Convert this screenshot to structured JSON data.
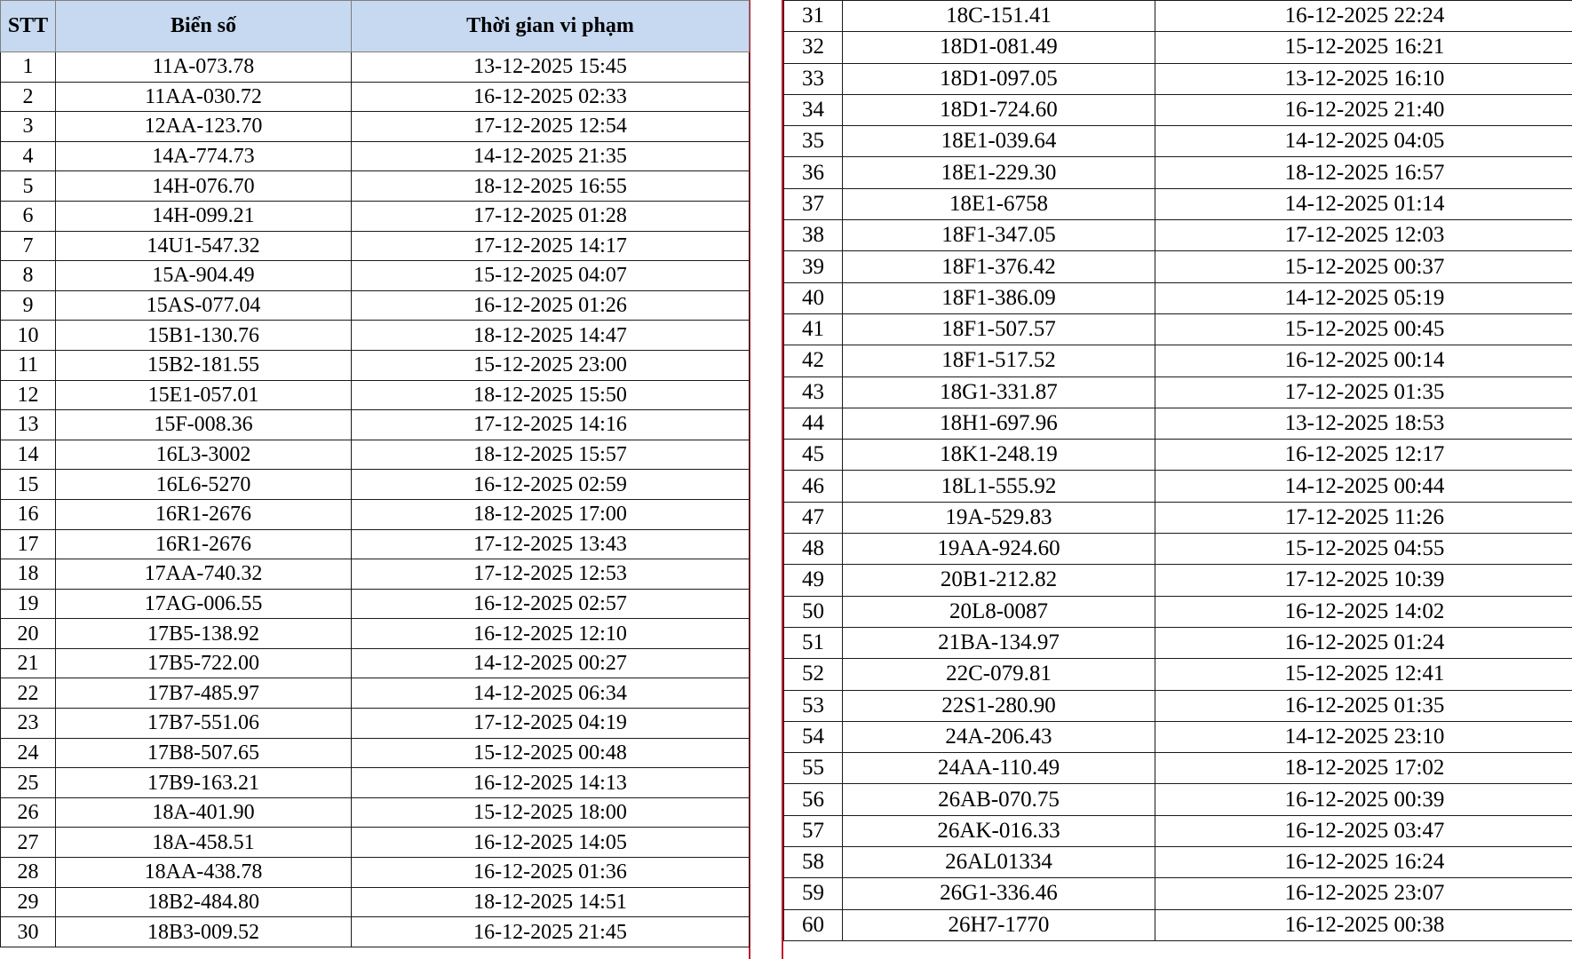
{
  "headers": {
    "stt": "STT",
    "plate": "Biển số",
    "time": "Thời gian vi phạm"
  },
  "colors": {
    "header_bg": "#c6d9f1",
    "divider": "#c01a2a"
  },
  "left_rows": [
    {
      "stt": "1",
      "plate": "11A-073.78",
      "time": "13-12-2025 15:45"
    },
    {
      "stt": "2",
      "plate": "11AA-030.72",
      "time": "16-12-2025 02:33"
    },
    {
      "stt": "3",
      "plate": "12AA-123.70",
      "time": "17-12-2025 12:54"
    },
    {
      "stt": "4",
      "plate": "14A-774.73",
      "time": "14-12-2025 21:35"
    },
    {
      "stt": "5",
      "plate": "14H-076.70",
      "time": "18-12-2025 16:55"
    },
    {
      "stt": "6",
      "plate": "14H-099.21",
      "time": "17-12-2025 01:28"
    },
    {
      "stt": "7",
      "plate": "14U1-547.32",
      "time": "17-12-2025 14:17"
    },
    {
      "stt": "8",
      "plate": "15A-904.49",
      "time": "15-12-2025 04:07"
    },
    {
      "stt": "9",
      "plate": "15AS-077.04",
      "time": "16-12-2025 01:26"
    },
    {
      "stt": "10",
      "plate": "15B1-130.76",
      "time": "18-12-2025 14:47"
    },
    {
      "stt": "11",
      "plate": "15B2-181.55",
      "time": "15-12-2025 23:00"
    },
    {
      "stt": "12",
      "plate": "15E1-057.01",
      "time": "18-12-2025 15:50"
    },
    {
      "stt": "13",
      "plate": "15F-008.36",
      "time": "17-12-2025 14:16"
    },
    {
      "stt": "14",
      "plate": "16L3-3002",
      "time": "18-12-2025 15:57"
    },
    {
      "stt": "15",
      "plate": "16L6-5270",
      "time": "16-12-2025 02:59"
    },
    {
      "stt": "16",
      "plate": "16R1-2676",
      "time": "18-12-2025 17:00"
    },
    {
      "stt": "17",
      "plate": "16R1-2676",
      "time": "17-12-2025 13:43"
    },
    {
      "stt": "18",
      "plate": "17AA-740.32",
      "time": "17-12-2025 12:53"
    },
    {
      "stt": "19",
      "plate": "17AG-006.55",
      "time": "16-12-2025 02:57"
    },
    {
      "stt": "20",
      "plate": "17B5-138.92",
      "time": "16-12-2025 12:10"
    },
    {
      "stt": "21",
      "plate": "17B5-722.00",
      "time": "14-12-2025 00:27"
    },
    {
      "stt": "22",
      "plate": "17B7-485.97",
      "time": "14-12-2025 06:34"
    },
    {
      "stt": "23",
      "plate": "17B7-551.06",
      "time": "17-12-2025 04:19"
    },
    {
      "stt": "24",
      "plate": "17B8-507.65",
      "time": "15-12-2025 00:48"
    },
    {
      "stt": "25",
      "plate": "17B9-163.21",
      "time": "16-12-2025 14:13"
    },
    {
      "stt": "26",
      "plate": "18A-401.90",
      "time": "15-12-2025 18:00"
    },
    {
      "stt": "27",
      "plate": "18A-458.51",
      "time": "16-12-2025 14:05"
    },
    {
      "stt": "28",
      "plate": "18AA-438.78",
      "time": "16-12-2025 01:36"
    },
    {
      "stt": "29",
      "plate": "18B2-484.80",
      "time": "18-12-2025 14:51"
    },
    {
      "stt": "30",
      "plate": "18B3-009.52",
      "time": "16-12-2025 21:45"
    }
  ],
  "right_rows": [
    {
      "stt": "31",
      "plate": "18C-151.41",
      "time": "16-12-2025 22:24"
    },
    {
      "stt": "32",
      "plate": "18D1-081.49",
      "time": "15-12-2025 16:21"
    },
    {
      "stt": "33",
      "plate": "18D1-097.05",
      "time": "13-12-2025 16:10"
    },
    {
      "stt": "34",
      "plate": "18D1-724.60",
      "time": "16-12-2025 21:40"
    },
    {
      "stt": "35",
      "plate": "18E1-039.64",
      "time": "14-12-2025 04:05"
    },
    {
      "stt": "36",
      "plate": "18E1-229.30",
      "time": "18-12-2025 16:57"
    },
    {
      "stt": "37",
      "plate": "18E1-6758",
      "time": "14-12-2025 01:14"
    },
    {
      "stt": "38",
      "plate": "18F1-347.05",
      "time": "17-12-2025 12:03"
    },
    {
      "stt": "39",
      "plate": "18F1-376.42",
      "time": "15-12-2025 00:37"
    },
    {
      "stt": "40",
      "plate": "18F1-386.09",
      "time": "14-12-2025 05:19"
    },
    {
      "stt": "41",
      "plate": "18F1-507.57",
      "time": "15-12-2025 00:45"
    },
    {
      "stt": "42",
      "plate": "18F1-517.52",
      "time": "16-12-2025 00:14"
    },
    {
      "stt": "43",
      "plate": "18G1-331.87",
      "time": "17-12-2025 01:35"
    },
    {
      "stt": "44",
      "plate": "18H1-697.96",
      "time": "13-12-2025 18:53"
    },
    {
      "stt": "45",
      "plate": "18K1-248.19",
      "time": "16-12-2025 12:17"
    },
    {
      "stt": "46",
      "plate": "18L1-555.92",
      "time": "14-12-2025 00:44"
    },
    {
      "stt": "47",
      "plate": "19A-529.83",
      "time": "17-12-2025 11:26"
    },
    {
      "stt": "48",
      "plate": "19AA-924.60",
      "time": "15-12-2025 04:55"
    },
    {
      "stt": "49",
      "plate": "20B1-212.82",
      "time": "17-12-2025 10:39"
    },
    {
      "stt": "50",
      "plate": "20L8-0087",
      "time": "16-12-2025 14:02"
    },
    {
      "stt": "51",
      "plate": "21BA-134.97",
      "time": "16-12-2025 01:24"
    },
    {
      "stt": "52",
      "plate": "22C-079.81",
      "time": "15-12-2025 12:41"
    },
    {
      "stt": "53",
      "plate": "22S1-280.90",
      "time": "16-12-2025 01:35"
    },
    {
      "stt": "54",
      "plate": "24A-206.43",
      "time": "14-12-2025 23:10"
    },
    {
      "stt": "55",
      "plate": "24AA-110.49",
      "time": "18-12-2025 17:02"
    },
    {
      "stt": "56",
      "plate": "26AB-070.75",
      "time": "16-12-2025 00:39"
    },
    {
      "stt": "57",
      "plate": "26AK-016.33",
      "time": "16-12-2025 03:47"
    },
    {
      "stt": "58",
      "plate": "26AL01334",
      "time": "16-12-2025 16:24"
    },
    {
      "stt": "59",
      "plate": "26G1-336.46",
      "time": "16-12-2025 23:07"
    },
    {
      "stt": "60",
      "plate": "26H7-1770",
      "time": "16-12-2025 00:38"
    }
  ]
}
